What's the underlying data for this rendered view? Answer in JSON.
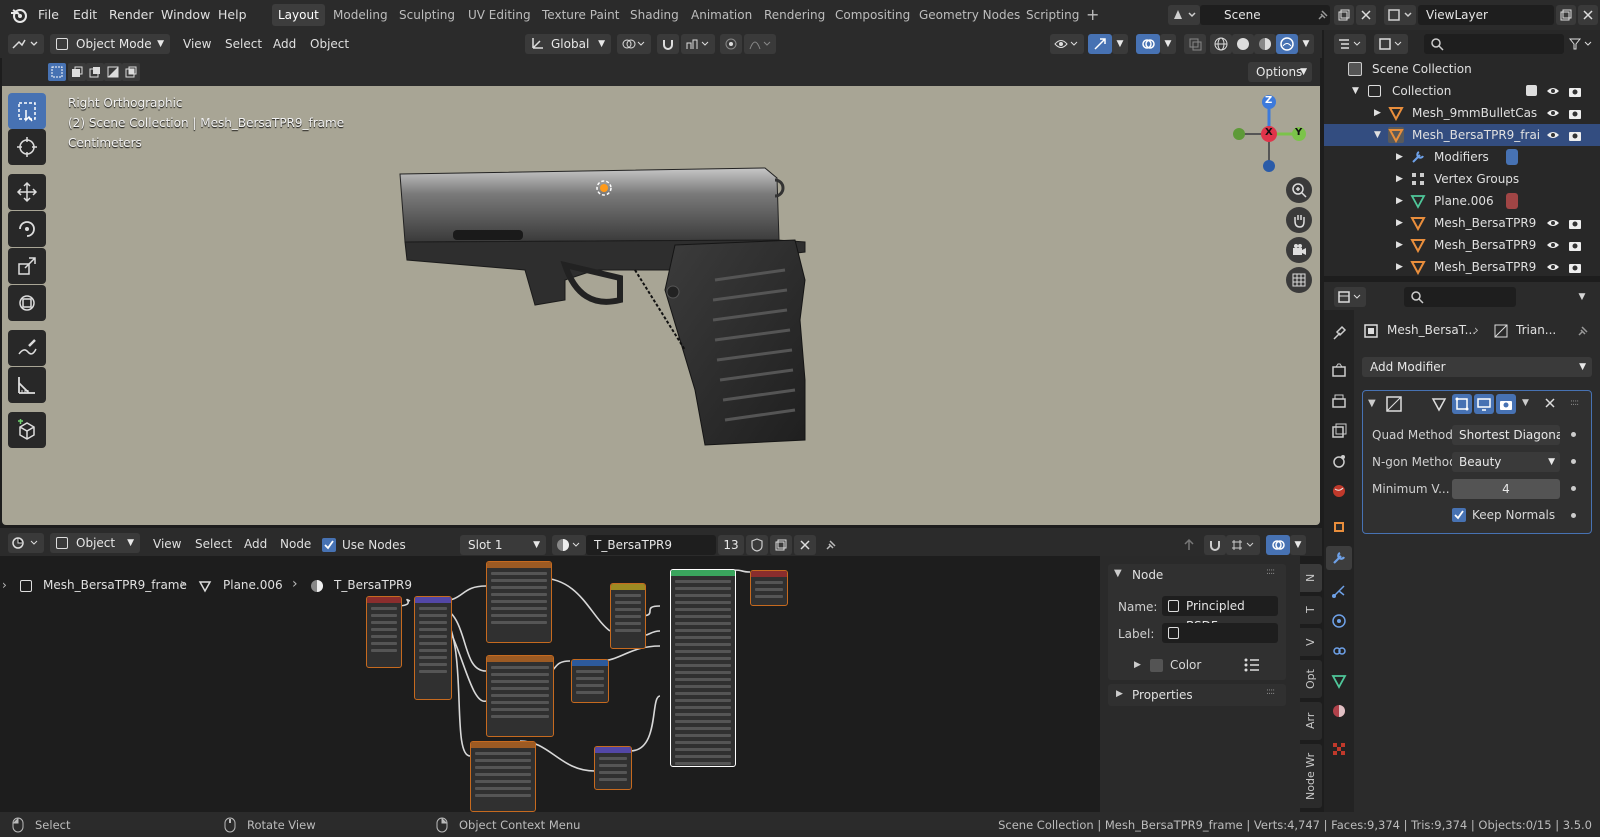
{
  "topbar": {
    "menus": [
      "File",
      "Edit",
      "Render",
      "Window",
      "Help"
    ],
    "workspaces": [
      "Layout",
      "Modeling",
      "Sculpting",
      "UV Editing",
      "Texture Paint",
      "Shading",
      "Animation",
      "Rendering",
      "Compositing",
      "Geometry Nodes",
      "Scripting"
    ],
    "active_workspace": "Layout",
    "scene": "Scene",
    "viewlayer": "ViewLayer"
  },
  "viewport": {
    "mode": "Object Mode",
    "menus": [
      "View",
      "Select",
      "Add",
      "Object"
    ],
    "orientation": "Global",
    "options_label": "Options",
    "overlay_view": "Right Orthographic",
    "overlay_collection": "(2) Scene Collection | Mesh_BersaTPR9_frame",
    "overlay_units": "Centimeters",
    "gizmo_axes": [
      "Z",
      "X",
      "Y"
    ],
    "background_color": "#a8a595"
  },
  "outliner": {
    "rows": [
      {
        "label": "Scene Collection"
      },
      {
        "label": "Collection"
      },
      {
        "label": "Mesh_9mmBulletCas"
      },
      {
        "label": "Mesh_BersaTPR9_frai"
      },
      {
        "label": "Modifiers"
      },
      {
        "label": "Vertex Groups"
      },
      {
        "label": "Plane.006"
      },
      {
        "label": "Mesh_BersaTPR9"
      },
      {
        "label": "Mesh_BersaTPR9"
      },
      {
        "label": "Mesh_BersaTPR9"
      }
    ]
  },
  "properties": {
    "breadcrumb_object": "Mesh_BersaT...",
    "breadcrumb_modifier": "Trian...",
    "add_modifier": "Add Modifier",
    "fields": [
      {
        "label": "Quad Method",
        "value": "Shortest Diagonal"
      },
      {
        "label": "N-gon Method",
        "value": "Beauty"
      },
      {
        "label": "Minimum V...",
        "value": "4"
      }
    ],
    "keep_normals_label": "Keep Normals",
    "keep_normals_checked": true
  },
  "node_editor": {
    "type": "Object",
    "menus": [
      "View",
      "Select",
      "Add",
      "Node"
    ],
    "use_nodes_label": "Use Nodes",
    "slot": "Slot 1",
    "material": "T_BersaTPR9",
    "users": "13",
    "breadcrumb": [
      "Mesh_BersaTPR9_frame",
      "Plane.006",
      "T_BersaTPR9"
    ],
    "panel_title": "Node",
    "name_label": "Name:",
    "name_value": "Principled BSDF",
    "label_label": "Label:",
    "label_value": "",
    "color_label": "Color",
    "properties_label": "Properties",
    "side_tabs": [
      "N",
      "T",
      "V",
      "Opt",
      "Arr",
      "Node Wr"
    ]
  },
  "statusbar": {
    "select": "Select",
    "rotate": "Rotate View",
    "context": "Object Context Menu",
    "stats": "Scene Collection | Mesh_BersaTPR9_frame | Verts:4,747 | Faces:9,374 | Tris:9,374 | Objects:0/15 | 3.5.0"
  },
  "colors": {
    "accent": "#4772b3",
    "node_texture": "#c66a1f",
    "node_shader": "#3aa55d"
  }
}
